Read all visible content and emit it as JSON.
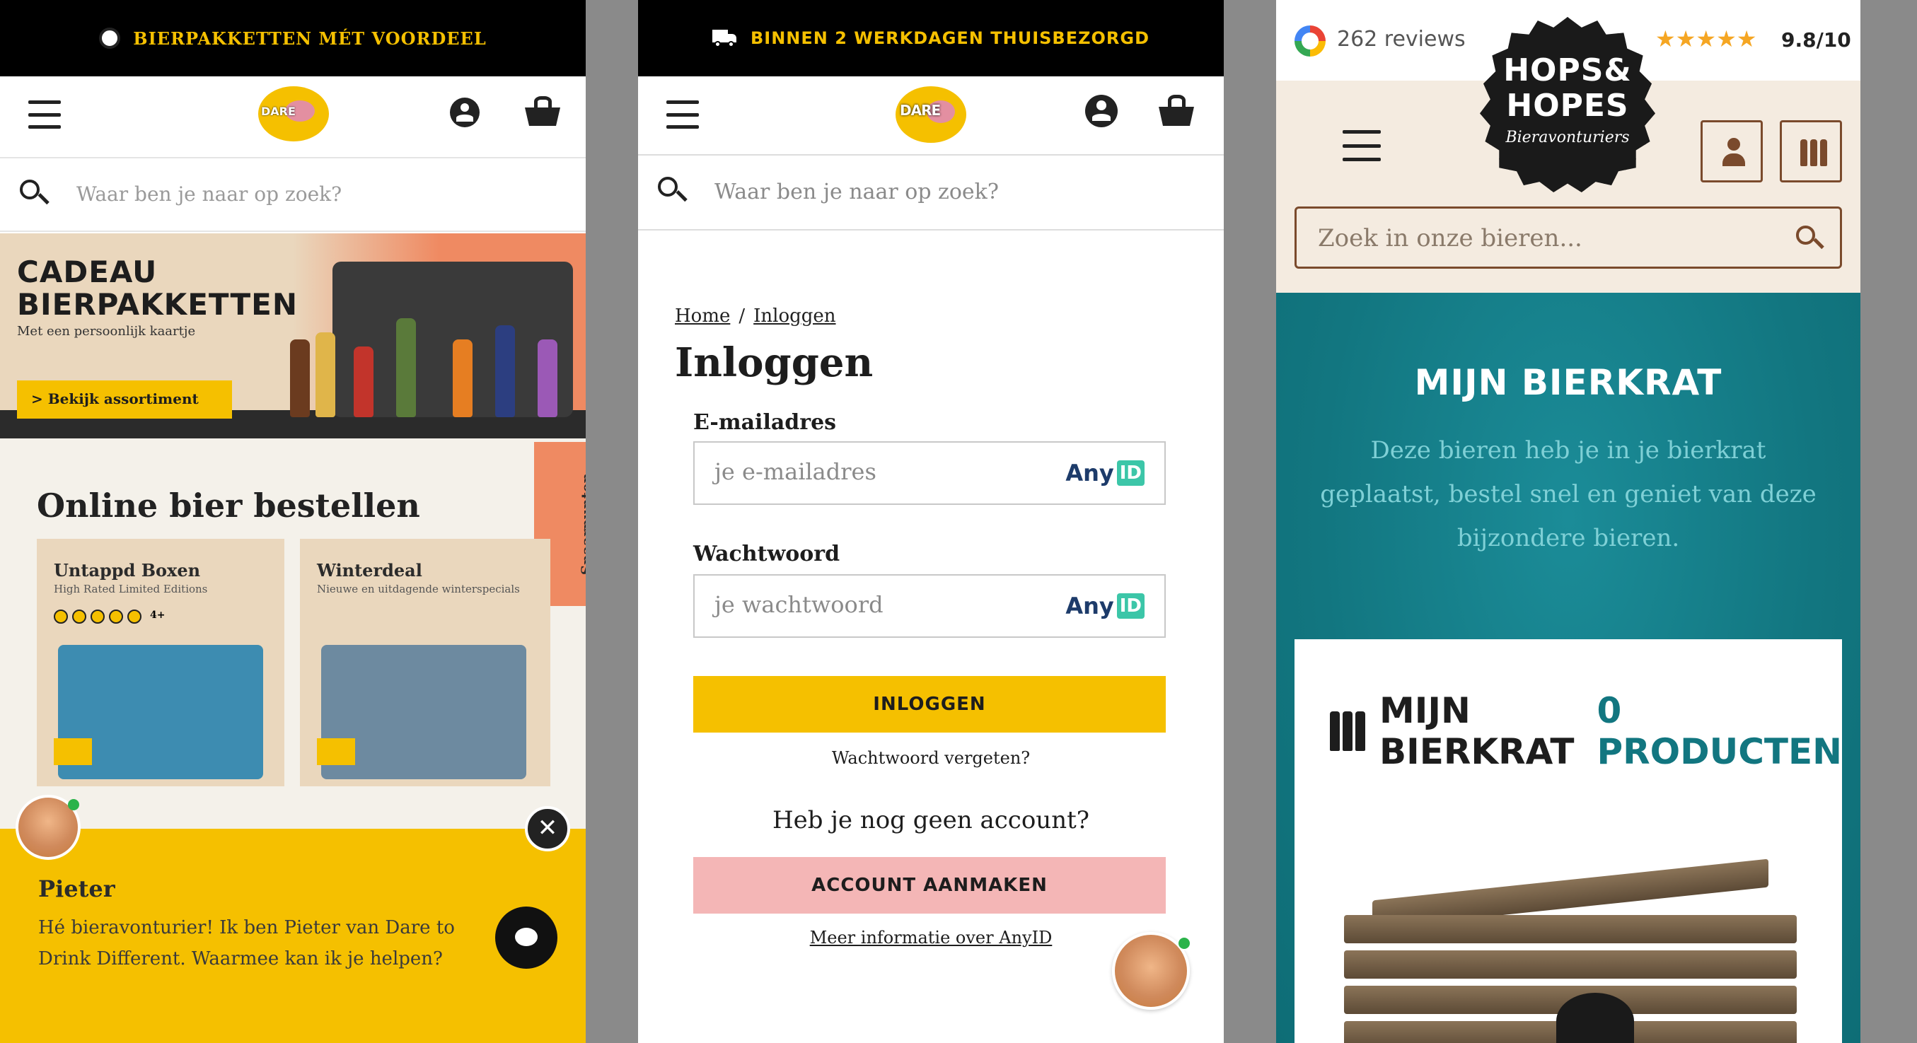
{
  "panel1": {
    "topbar_text": "BIERPAKKETTEN MÉT VOORDEEL",
    "logo_text": "DARE",
    "search_placeholder": "Waar ben je naar op zoek?",
    "banner": {
      "title_line1": "CADEAU",
      "title_line2": "BIERPAKKETTEN",
      "subtitle": "Met een persoonlijk kaartje",
      "button": "> Bekijk assortiment"
    },
    "section_title": "Online bier bestellen",
    "side_tab": "Spaarpunten",
    "cards": [
      {
        "title": "Untappd Boxen",
        "subtitle": "High Rated Limited Editions",
        "rating_note": "4+"
      },
      {
        "title": "Winterdeal",
        "subtitle": "Nieuwe en uitdagende winterspecials"
      }
    ],
    "chat": {
      "name": "Pieter",
      "message": "Hé bieravonturier! Ik ben Pieter van Dare to Drink Different. Waarmee kan ik je helpen?",
      "close": "✕"
    }
  },
  "panel2": {
    "topbar_text": "BINNEN 2 WERKDAGEN THUISBEZORGD",
    "logo_text": "DARE",
    "search_placeholder": "Waar ben je naar op zoek?",
    "breadcrumb": {
      "home": "Home",
      "sep": "/",
      "current": "Inloggen"
    },
    "title": "Inloggen",
    "email_label": "E-mailadres",
    "email_placeholder": "je e-mailadres",
    "password_label": "Wachtwoord",
    "password_placeholder": "je wachtwoord",
    "anyid_any": "Any",
    "anyid_id": "ID",
    "login_button": "INLOGGEN",
    "forgot_link": "Wachtwoord vergeten?",
    "no_account": "Heb je nog geen account?",
    "create_button": "ACCOUNT AANMAKEN",
    "more_info_link": "Meer informatie over AnyID"
  },
  "panel3": {
    "reviews": "262 reviews",
    "stars": "★★★★★",
    "score": "9.8/10",
    "logo": {
      "line1": "HOPS&",
      "line2": "HOPES",
      "line3": "Bieravonturiers"
    },
    "search_placeholder": "Zoek in onze bieren...",
    "title": "MIJN BIERKRAT",
    "intro": "Deze bieren heb je in je bierkrat geplaatst, bestel snel en geniet van deze bijzondere bieren.",
    "card_title": "MIJN BIERKRAT",
    "card_count": "0 PRODUCTEN"
  },
  "colors": {
    "dare_yellow": "#f5c000",
    "dare_pink": "#f4b6b6",
    "hops_teal": "#127680",
    "hops_brown": "#7a4a2c"
  }
}
